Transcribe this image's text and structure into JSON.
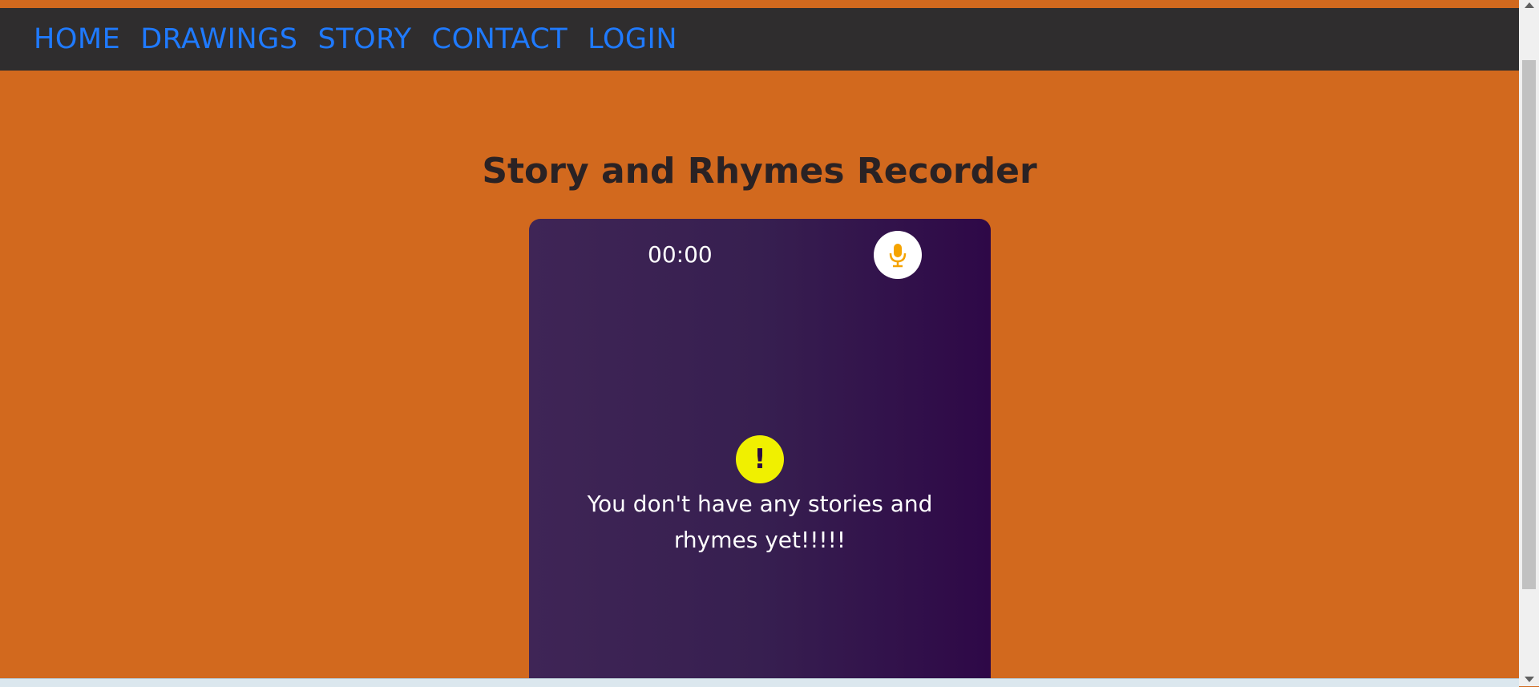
{
  "nav": {
    "items": [
      {
        "label": "HOME"
      },
      {
        "label": "DRAWINGS"
      },
      {
        "label": "STORY"
      },
      {
        "label": "CONTACT"
      },
      {
        "label": "LOGIN"
      }
    ]
  },
  "page": {
    "title": "Story and Rhymes Recorder"
  },
  "recorder": {
    "timer": "00:00",
    "mic_icon": "microphone-icon",
    "empty_icon": "exclamation-icon",
    "empty_icon_glyph": "!",
    "empty_message": "You don't have any stories and rhymes yet!!!!!"
  },
  "colors": {
    "page_background": "#d2691e",
    "navbar": "#2f2d2e",
    "nav_link": "#1f7aff",
    "card_gradient_start": "#3f2556",
    "card_gradient_end": "#2e0847",
    "mic_icon": "#f5a300",
    "warning_badge": "#f0f000"
  }
}
